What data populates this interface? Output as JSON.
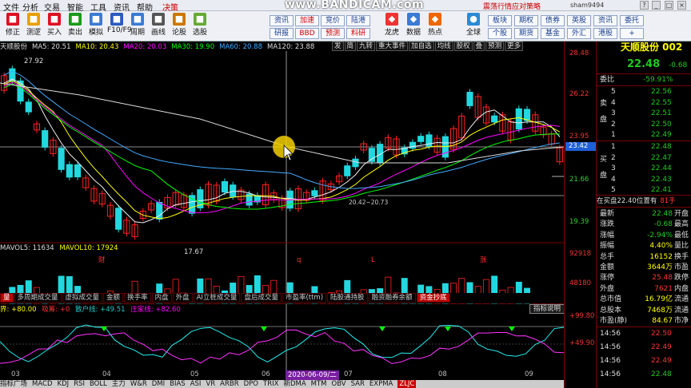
{
  "menubar": {
    "items": [
      "文件",
      "分析",
      "交易",
      "智能",
      "工具",
      "资讯",
      "帮助"
    ],
    "special": "决策",
    "watermark": "www.BANDICAM.com",
    "promo": "震荡行情应对策略",
    "user": "sham9494",
    "win_buttons": [
      "?",
      "_",
      "□",
      "×"
    ]
  },
  "toolbar": {
    "left_buttons": [
      {
        "label": "修正",
        "icon": "edit-icon",
        "color": "#d12"
      },
      {
        "label": "测逻",
        "icon": "bulb-icon",
        "color": "#e8a000"
      },
      {
        "label": "买入",
        "icon": "buy-icon",
        "color": "#d12"
      },
      {
        "label": "卖出",
        "icon": "sell-icon",
        "color": "#1a9a1a"
      },
      {
        "label": "模拟",
        "icon": "sim-icon",
        "color": "#3a7bd5"
      },
      {
        "label": "F10/F9",
        "icon": "f10-icon",
        "color": "#2a5bbf"
      },
      {
        "label": "周期",
        "icon": "cycle-icon",
        "color": "#3a7bd5"
      },
      {
        "label": "画线",
        "icon": "pen-icon",
        "color": "#555"
      },
      {
        "label": "论股",
        "icon": "chat-icon",
        "color": "#c70"
      },
      {
        "label": "选股",
        "icon": "filter-icon",
        "color": "#6a3"
      }
    ],
    "mid_row1": [
      "资讯",
      "加速",
      "竞价",
      "陆港"
    ],
    "mid_row2": [
      "研报",
      "BBD",
      "预测",
      "料研"
    ],
    "mid_icons": [
      "龙虎",
      "数据",
      "热点"
    ],
    "mid_plain": [
      "全球"
    ],
    "right_row1": [
      "板块",
      "期权",
      "债券",
      "英股",
      "资讯",
      "委托"
    ],
    "right_row2": [
      "个股",
      "期货",
      "基金",
      "外汇",
      "港股",
      "+"
    ]
  },
  "infobar": {
    "title": "天顺股份",
    "ma": [
      {
        "label": "MA5: 20.51",
        "color": "#ddd"
      },
      {
        "label": "MA10: 20.43",
        "color": "#ff0"
      },
      {
        "label": "MA20: 20.03",
        "color": "#f0f"
      },
      {
        "label": "MA30: 19.90",
        "color": "#0f0"
      },
      {
        "label": "MA60: 20.88",
        "color": "#4af"
      },
      {
        "label": "MA120: 23.88",
        "color": "#ddd"
      }
    ],
    "tools": [
      "发",
      "简",
      "九转",
      "重大事件",
      "加自选",
      "均线",
      "股权",
      "叠",
      "预测",
      "更多"
    ]
  },
  "axis": {
    "price_labels": [
      "28.48",
      "26.22",
      "23.95",
      "21.66",
      "19.39"
    ],
    "current_price": "23.42",
    "vol_labels": [
      "92918",
      "48180"
    ],
    "ind_labels": [
      "+99.80",
      "+49.90"
    ]
  },
  "chart_notes": {
    "high": "27.92",
    "low": "17.67",
    "mid_note": "20.42~20.73",
    "markers": [
      "财",
      "q",
      "L",
      "涨"
    ]
  },
  "volume_bar": {
    "mavol5": "MAVOL5: 11634",
    "mavol10": "MAVOL10: 17924"
  },
  "tabs": [
    "量",
    "多周期成交量",
    "虚拟成交量",
    "金额",
    "换手率",
    "内盘",
    "外盘",
    "AI立桩成交量",
    "盘后成交量",
    "市盈率(ttm)",
    "陆股通持股",
    "融资融券余额",
    "资金抄底"
  ],
  "indicator": {
    "jie": "界: +80.00",
    "xi": "吸筹: +0",
    "san": "散户线: +49.51",
    "zhuang": "庄家线: +82.60",
    "explain": "指标说明"
  },
  "dates": [
    "03",
    "04",
    "05",
    "06",
    "07",
    "08",
    "09"
  ],
  "date_pill": "2020-06-09/二",
  "bottom_tabs": [
    "指标广场",
    "MACD",
    "KDJ",
    "RSI",
    "BOLL",
    "主力",
    "W&R",
    "DMI",
    "BIAS",
    "ASI",
    "VR",
    "ARBR",
    "DPO",
    "TRIX",
    "新DMA",
    "MTM",
    "OBV",
    "SAR",
    "EXPMA",
    "ZLJC"
  ],
  "panel": {
    "name": "天顺股份 002",
    "price": "22.48",
    "chg": "-0.68",
    "weibi_label": "委比",
    "weibi": "-59.91%",
    "sell": [
      [
        "5",
        "22.56"
      ],
      [
        "4",
        "22.55"
      ],
      [
        "3",
        "22.51"
      ],
      [
        "2",
        "22.50"
      ],
      [
        "1",
        "22.49"
      ]
    ],
    "buy": [
      [
        "1",
        "22.48"
      ],
      [
        "2",
        "22.47"
      ],
      [
        "3",
        "22.44"
      ],
      [
        "4",
        "22.43"
      ],
      [
        "5",
        "22.41"
      ]
    ],
    "sell_side": [
      "卖",
      "盘"
    ],
    "buy_side": [
      "买",
      "盘"
    ],
    "note": "在买盘22.40位置有",
    "note_qty": "81手",
    "stats": [
      [
        "最新",
        "22.48",
        "开盘"
      ],
      [
        "涨跌",
        "-0.68",
        "最高"
      ],
      [
        "涨幅",
        "-2.94%",
        "最低"
      ],
      [
        "振幅",
        "4.40%",
        "量比"
      ],
      [
        "总手",
        "16152",
        "换手"
      ],
      [
        "金额",
        "3644万",
        "市盈"
      ],
      [
        "涨停",
        "25.48",
        "跌停"
      ],
      [
        "外盘",
        "7621",
        "内盘"
      ],
      [
        "总市值",
        "16.79亿",
        "流通"
      ],
      [
        "总股本",
        "7468万",
        "流通"
      ],
      [
        "市盈(静)",
        "84.67",
        "市净"
      ]
    ],
    "ticks": [
      [
        "14:56",
        "22.50"
      ],
      [
        "14:56",
        "22.49"
      ],
      [
        "14:56",
        "22.49"
      ],
      [
        "14:56",
        "22.48"
      ]
    ]
  }
}
